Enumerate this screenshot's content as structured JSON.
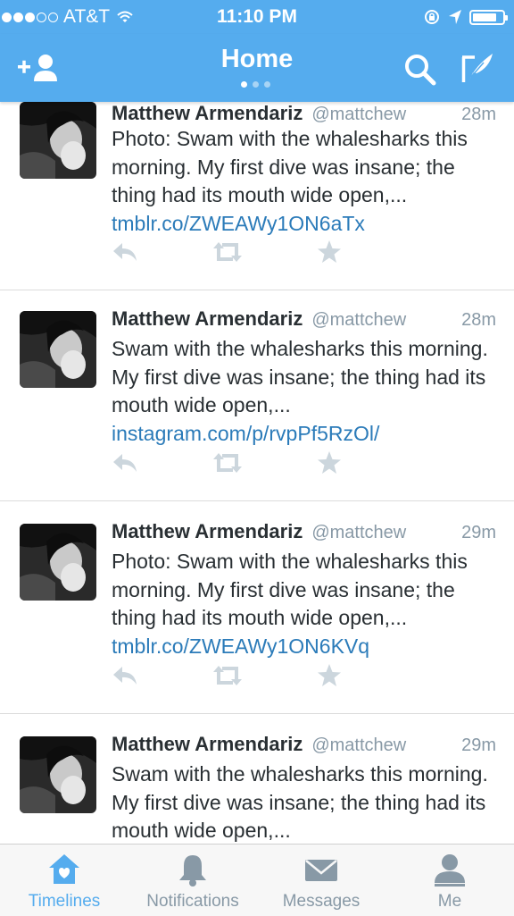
{
  "status": {
    "carrier": "AT&T",
    "time": "11:10 PM"
  },
  "nav": {
    "title": "Home"
  },
  "tweets": [
    {
      "name": "Matthew Armendariz",
      "handle": "@mattchew",
      "time": "28m",
      "text": "Photo: Swam with the whalesharks this morning. My first dive was insane; the thing had its mouth wide open,...",
      "link": "tmblr.co/ZWEAWy1ON6aTx"
    },
    {
      "name": "Matthew Armendariz",
      "handle": "@mattchew",
      "time": "28m",
      "text": "Swam with the whalesharks this morning. My first dive was insane; the thing had its mouth wide open,...",
      "link": "instagram.com/p/rvpPf5RzOl/"
    },
    {
      "name": "Matthew Armendariz",
      "handle": "@mattchew",
      "time": "29m",
      "text": "Photo: Swam with the whalesharks this morning. My first dive was insane; the thing had its mouth wide open,...",
      "link": "tmblr.co/ZWEAWy1ON6KVq"
    },
    {
      "name": "Matthew Armendariz",
      "handle": "@mattchew",
      "time": "29m",
      "text": "Swam with the whalesharks this morning. My first dive was insane; the thing had its mouth wide open,...",
      "link": ""
    }
  ],
  "tabs": [
    {
      "label": "Timelines",
      "icon": "home-icon",
      "active": true
    },
    {
      "label": "Notifications",
      "icon": "bell-icon",
      "active": false
    },
    {
      "label": "Messages",
      "icon": "envelope-icon",
      "active": false
    },
    {
      "label": "Me",
      "icon": "person-icon",
      "active": false
    }
  ],
  "colors": {
    "brand": "#55acee",
    "link": "#2b7bb9",
    "muted": "#8899a6",
    "text": "#292f33"
  }
}
